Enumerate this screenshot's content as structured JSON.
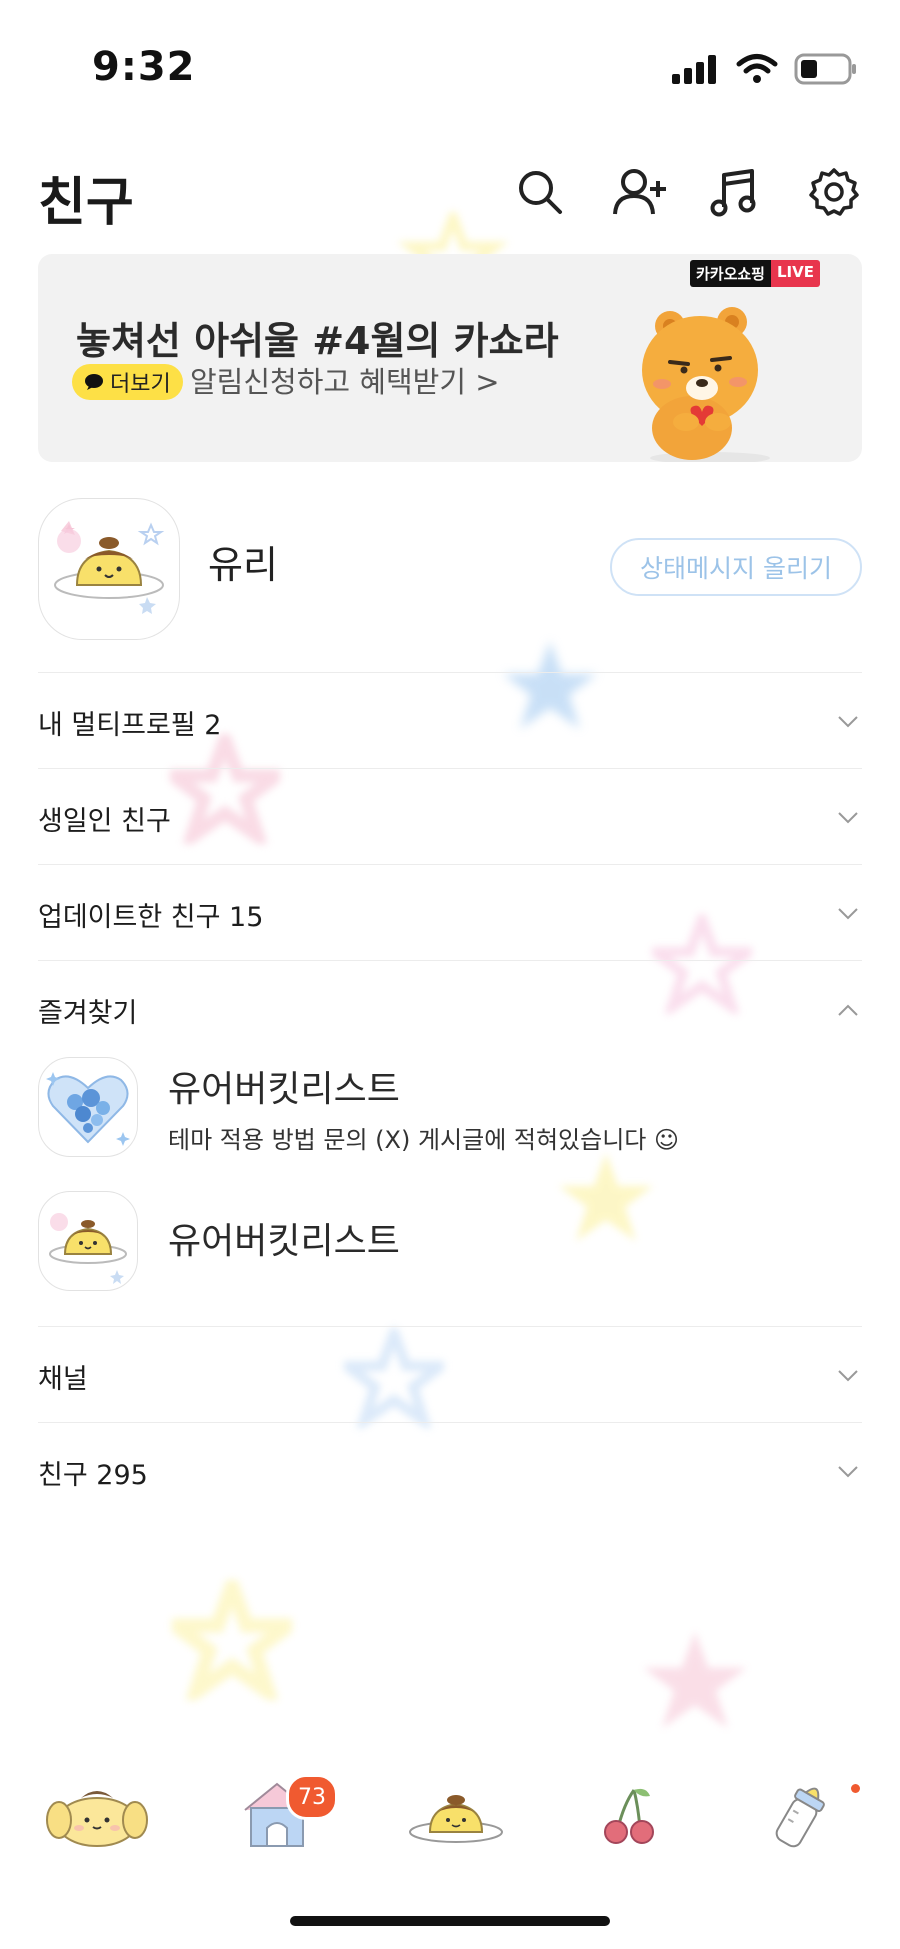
{
  "status_bar": {
    "time": "9:32"
  },
  "header": {
    "title": "친구"
  },
  "banner": {
    "title": "놓쳐선 아쉬울 #4월의 카쇼라",
    "more_label": "더보기",
    "subtitle": "알림신청하고 혜택받기 >",
    "badge_brand": "카카오쇼핑",
    "badge_live": "LIVE"
  },
  "profile": {
    "name": "유리",
    "status_button": "상태메시지 올리기"
  },
  "sections": {
    "multi_profile": "내 멀티프로필 2",
    "birthday": "생일인 친구",
    "updated": "업데이트한 친구 15",
    "favorites": "즐겨찾기",
    "channel": "채널",
    "friends": "친구 295"
  },
  "favorites": [
    {
      "name": "유어버킷리스트",
      "message": "테마 적용 방법 문의 (X) 게시글에 적혀있습니다 ☺"
    },
    {
      "name": "유어버킷리스트"
    }
  ],
  "tabs": {
    "chat_badge": "73"
  },
  "colors": {
    "accent_yellow": "#fde046",
    "badge_red": "#f05a30",
    "live_red": "#e8354d"
  }
}
